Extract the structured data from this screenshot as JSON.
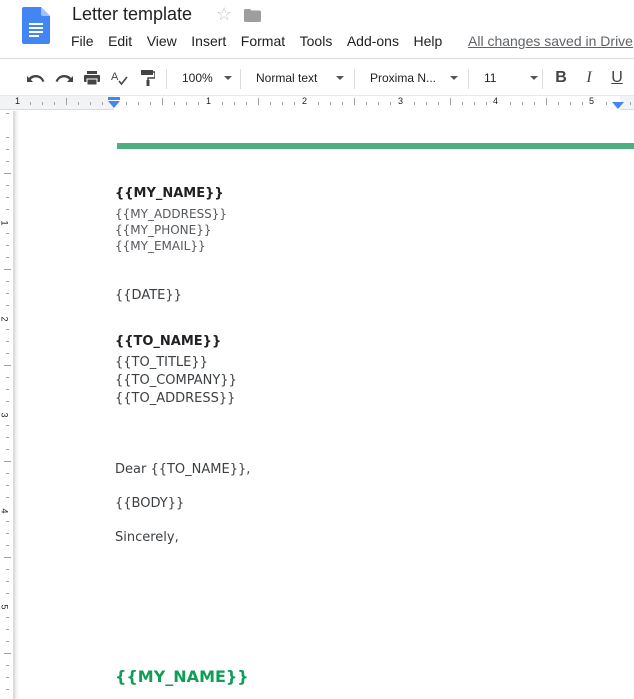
{
  "app": {
    "name": "Google Docs",
    "document_title": "Letter template",
    "save_status": "All changes saved in Drive"
  },
  "menu": {
    "items": [
      "File",
      "Edit",
      "View",
      "Insert",
      "Format",
      "Tools",
      "Add-ons",
      "Help"
    ]
  },
  "toolbar": {
    "zoom": "100%",
    "style": "Normal text",
    "font": "Proxima N...",
    "font_size": "11",
    "bold_label": "B",
    "italic_label": "I",
    "underline_label": "U"
  },
  "ruler": {
    "horizontal_labels": [
      "1",
      "1",
      "2",
      "3",
      "4",
      "5"
    ],
    "vertical_labels": [
      "1",
      "2",
      "3",
      "4",
      "5"
    ]
  },
  "document": {
    "accent_color": "#4caf7d",
    "signature_color": "#0f9d58",
    "sender_name": "{{MY_NAME}}",
    "sender_address": "{{MY_ADDRESS}}",
    "sender_phone": "{{MY_PHONE}}",
    "sender_email": "{{MY_EMAIL}}",
    "date": "{{DATE}}",
    "recipient_name": "{{TO_NAME}}",
    "recipient_title": "{{TO_TITLE}}",
    "recipient_company": "{{TO_COMPANY}}",
    "recipient_address": "{{TO_ADDRESS}}",
    "salutation": "Dear {{TO_NAME}},",
    "body": "{{BODY}}",
    "closing": "Sincerely,",
    "signature": "{{MY_NAME}}"
  },
  "colors": {
    "docs_blue": "#4285f4",
    "ruler_marker": "#4285f4"
  }
}
